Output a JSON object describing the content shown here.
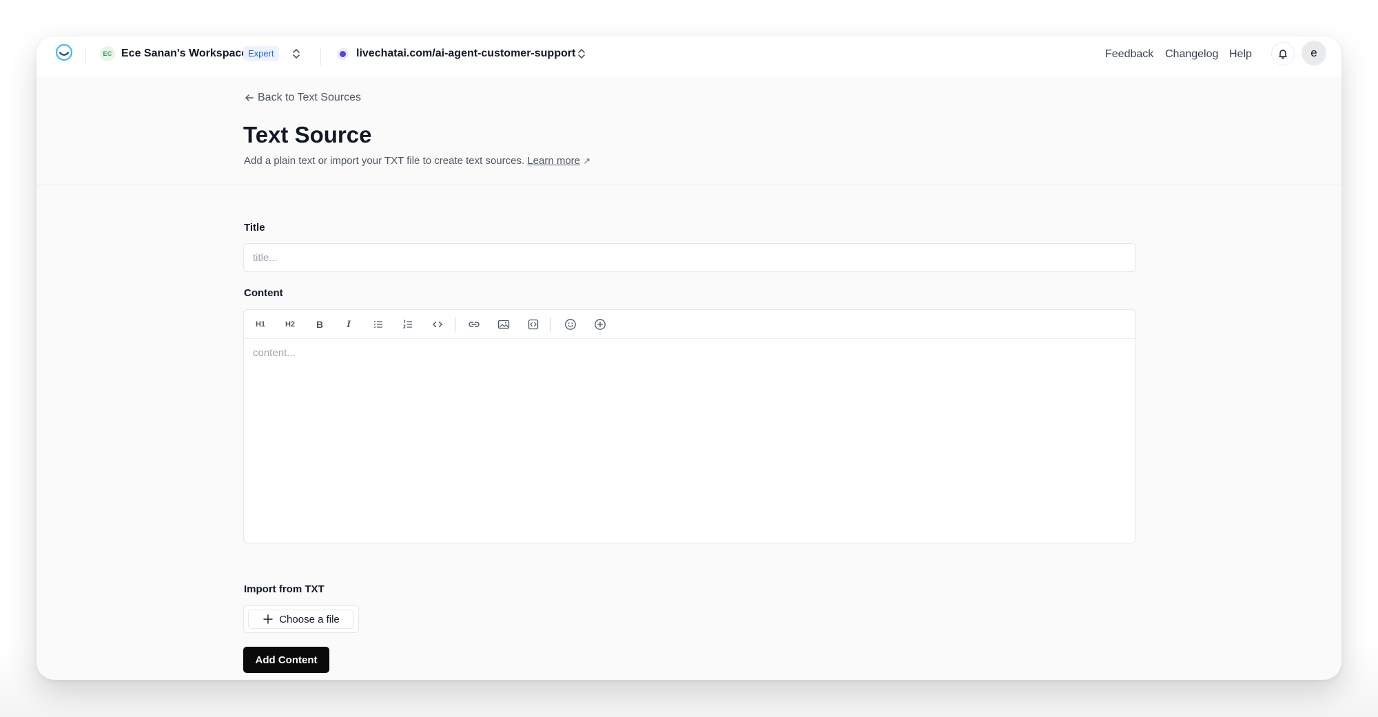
{
  "topbar": {
    "workspace_initials": "EC",
    "workspace_name": "Ece Sanan's Workspace",
    "plan_badge": "Expert",
    "site_url": "livechatai.com/ai-agent-customer-support",
    "links": [
      "Feedback",
      "Changelog",
      "Help"
    ],
    "user_initial": "e",
    "icons": [
      "logo-icon",
      "chevron-updown-icon",
      "bell-icon"
    ]
  },
  "header": {
    "back_label": "Back to Text Sources",
    "title": "Text Source",
    "subtitle": "Add a plain text or import your TXT file to create text sources.",
    "learn_more": "Learn more",
    "learn_more_arrow": "↗"
  },
  "form": {
    "title_label": "Title",
    "title_placeholder": "title...",
    "title_value": "",
    "content_label": "Content",
    "content_placeholder": "content...",
    "toolbar": {
      "h1": "H1",
      "h2": "H2",
      "bold": "B",
      "italic": "I",
      "icons": [
        "bullet-list-icon",
        "numbered-list-icon",
        "code-icon",
        "link-icon",
        "image-icon",
        "embed-icon",
        "emoji-icon",
        "plus-circle-icon"
      ]
    },
    "import_label": "Import from TXT",
    "choose_file": "Choose a file",
    "submit": "Add Content"
  },
  "colors": {
    "accent_badge_bg": "#eef2ff",
    "accent_badge_text": "#2563eb",
    "site_dot": "#4f46e5",
    "primary_button": "#0a0a0a"
  }
}
